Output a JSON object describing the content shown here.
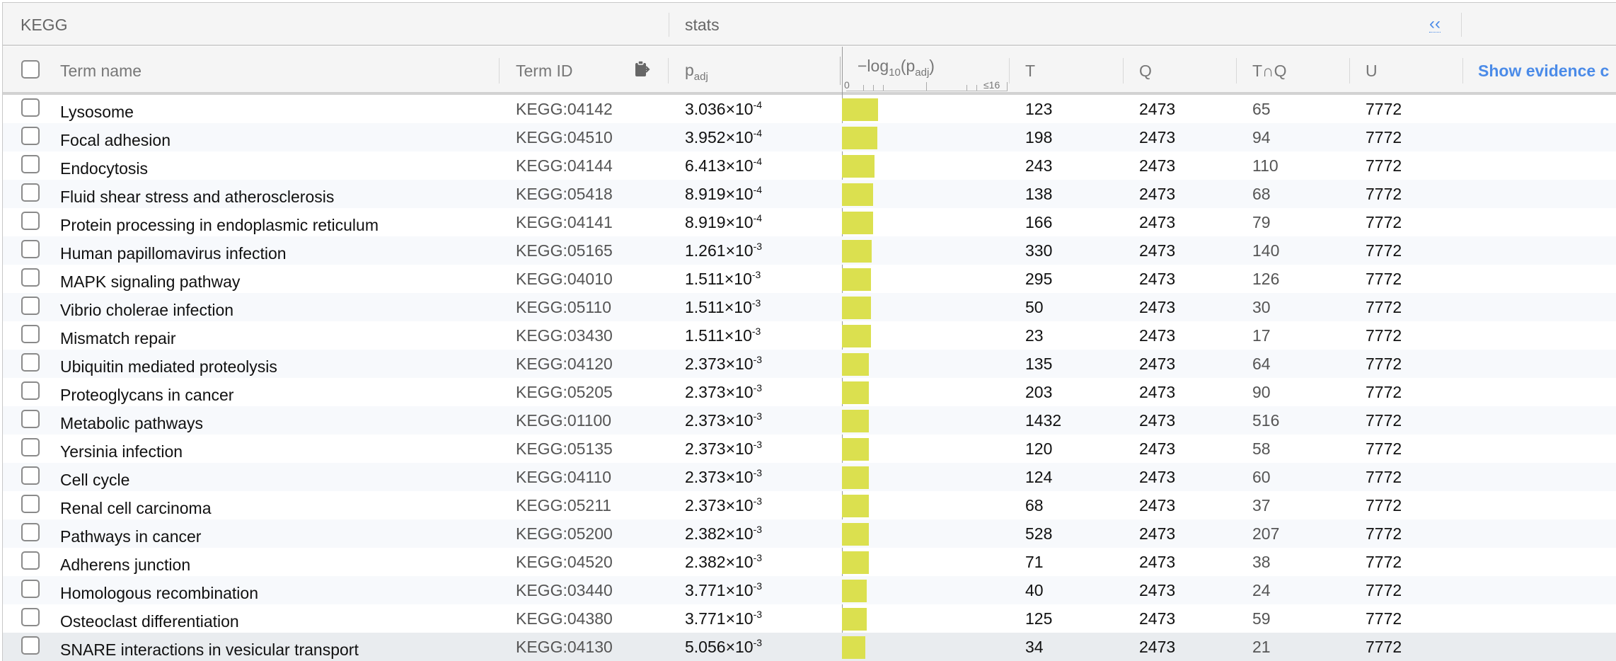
{
  "group_header": {
    "source": "KEGG",
    "stats": "stats",
    "collapse_icon": "‹‹"
  },
  "columns": {
    "term_name": "Term name",
    "term_id": "Term ID",
    "padj_base": "p",
    "padj_sub": "adj",
    "neglog_prefix": "−log",
    "neglog_base_sub": "10",
    "neglog_paren_open": "(p",
    "neglog_paren_sub": "adj",
    "neglog_paren_close": ")",
    "axis_min": "0",
    "axis_max": "≤16",
    "t": "T",
    "q": "Q",
    "tq": "T∩Q",
    "u": "U",
    "show_evidence": "Show evidence c"
  },
  "bar_color": "#dbe04f",
  "rows": [
    {
      "name": "Lysosome",
      "id": "KEGG:04142",
      "padj_mant": "3.036",
      "padj_exp": "-4",
      "neglog": 3.518,
      "t": "123",
      "q": "2473",
      "tq": "65",
      "u": "7772"
    },
    {
      "name": "Focal adhesion",
      "id": "KEGG:04510",
      "padj_mant": "3.952",
      "padj_exp": "-4",
      "neglog": 3.403,
      "t": "198",
      "q": "2473",
      "tq": "94",
      "u": "7772"
    },
    {
      "name": "Endocytosis",
      "id": "KEGG:04144",
      "padj_mant": "6.413",
      "padj_exp": "-4",
      "neglog": 3.193,
      "t": "243",
      "q": "2473",
      "tq": "110",
      "u": "7772"
    },
    {
      "name": "Fluid shear stress and atherosclerosis",
      "id": "KEGG:05418",
      "padj_mant": "8.919",
      "padj_exp": "-4",
      "neglog": 3.05,
      "t": "138",
      "q": "2473",
      "tq": "68",
      "u": "7772"
    },
    {
      "name": "Protein processing in endoplasmic reticulum",
      "id": "KEGG:04141",
      "padj_mant": "8.919",
      "padj_exp": "-4",
      "neglog": 3.05,
      "t": "166",
      "q": "2473",
      "tq": "79",
      "u": "7772"
    },
    {
      "name": "Human papillomavirus infection",
      "id": "KEGG:05165",
      "padj_mant": "1.261",
      "padj_exp": "-3",
      "neglog": 2.899,
      "t": "330",
      "q": "2473",
      "tq": "140",
      "u": "7772"
    },
    {
      "name": "MAPK signaling pathway",
      "id": "KEGG:04010",
      "padj_mant": "1.511",
      "padj_exp": "-3",
      "neglog": 2.821,
      "t": "295",
      "q": "2473",
      "tq": "126",
      "u": "7772"
    },
    {
      "name": "Vibrio cholerae infection",
      "id": "KEGG:05110",
      "padj_mant": "1.511",
      "padj_exp": "-3",
      "neglog": 2.821,
      "t": "50",
      "q": "2473",
      "tq": "30",
      "u": "7772"
    },
    {
      "name": "Mismatch repair",
      "id": "KEGG:03430",
      "padj_mant": "1.511",
      "padj_exp": "-3",
      "neglog": 2.821,
      "t": "23",
      "q": "2473",
      "tq": "17",
      "u": "7772"
    },
    {
      "name": "Ubiquitin mediated proteolysis",
      "id": "KEGG:04120",
      "padj_mant": "2.373",
      "padj_exp": "-3",
      "neglog": 2.625,
      "t": "135",
      "q": "2473",
      "tq": "64",
      "u": "7772"
    },
    {
      "name": "Proteoglycans in cancer",
      "id": "KEGG:05205",
      "padj_mant": "2.373",
      "padj_exp": "-3",
      "neglog": 2.625,
      "t": "203",
      "q": "2473",
      "tq": "90",
      "u": "7772"
    },
    {
      "name": "Metabolic pathways",
      "id": "KEGG:01100",
      "padj_mant": "2.373",
      "padj_exp": "-3",
      "neglog": 2.625,
      "t": "1432",
      "q": "2473",
      "tq": "516",
      "u": "7772"
    },
    {
      "name": "Yersinia infection",
      "id": "KEGG:05135",
      "padj_mant": "2.373",
      "padj_exp": "-3",
      "neglog": 2.625,
      "t": "120",
      "q": "2473",
      "tq": "58",
      "u": "7772"
    },
    {
      "name": "Cell cycle",
      "id": "KEGG:04110",
      "padj_mant": "2.373",
      "padj_exp": "-3",
      "neglog": 2.625,
      "t": "124",
      "q": "2473",
      "tq": "60",
      "u": "7772"
    },
    {
      "name": "Renal cell carcinoma",
      "id": "KEGG:05211",
      "padj_mant": "2.373",
      "padj_exp": "-3",
      "neglog": 2.625,
      "t": "68",
      "q": "2473",
      "tq": "37",
      "u": "7772"
    },
    {
      "name": "Pathways in cancer",
      "id": "KEGG:05200",
      "padj_mant": "2.382",
      "padj_exp": "-3",
      "neglog": 2.623,
      "t": "528",
      "q": "2473",
      "tq": "207",
      "u": "7772"
    },
    {
      "name": "Adherens junction",
      "id": "KEGG:04520",
      "padj_mant": "2.382",
      "padj_exp": "-3",
      "neglog": 2.623,
      "t": "71",
      "q": "2473",
      "tq": "38",
      "u": "7772"
    },
    {
      "name": "Homologous recombination",
      "id": "KEGG:03440",
      "padj_mant": "3.771",
      "padj_exp": "-3",
      "neglog": 2.424,
      "t": "40",
      "q": "2473",
      "tq": "24",
      "u": "7772"
    },
    {
      "name": "Osteoclast differentiation",
      "id": "KEGG:04380",
      "padj_mant": "3.771",
      "padj_exp": "-3",
      "neglog": 2.424,
      "t": "125",
      "q": "2473",
      "tq": "59",
      "u": "7772"
    },
    {
      "name": "SNARE interactions in vesicular transport",
      "id": "KEGG:04130",
      "padj_mant": "5.056",
      "padj_exp": "-3",
      "neglog": 2.296,
      "t": "34",
      "q": "2473",
      "tq": "21",
      "u": "7772"
    }
  ]
}
